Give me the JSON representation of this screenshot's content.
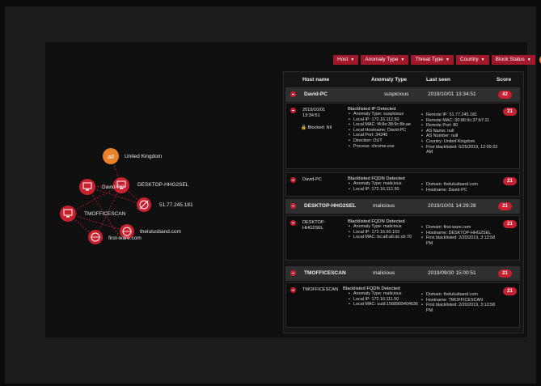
{
  "filters": [
    "Host",
    "Anomaly Type",
    "Threat Type",
    "Country",
    "Block Status"
  ],
  "user_badge": "a8",
  "colors": {
    "accent": "#c8202f",
    "filter_bg": "#a0182a",
    "node_orange": "#e8812a",
    "panel_bg": "#151515"
  },
  "graph": {
    "nodes": [
      {
        "label": "United Kingdom",
        "icon": "globe-icon"
      },
      {
        "label": "David-PC",
        "icon": "computer-icon"
      },
      {
        "label": "DESKTOP-HHG2SEL",
        "icon": "computer-icon"
      },
      {
        "label": "51.77.245.181",
        "icon": "ip-icon"
      },
      {
        "label": "TMOFFICESCAN",
        "icon": "computer-icon"
      },
      {
        "label": "thelulusband.com",
        "icon": "domain-icon"
      },
      {
        "label": "first-ware.com",
        "icon": "domain-icon"
      }
    ]
  },
  "table": {
    "headers": {
      "host": "Host name",
      "type": "Anomaly Type",
      "seen": "Last seen",
      "score": "Score"
    },
    "groups": [
      {
        "host": "David-PC",
        "type": "suspicious",
        "seen": "2019/10/01 13:34:51",
        "score": "42"
      },
      {
        "host": "DESKTOP-HHG2SEL",
        "type": "malicious",
        "seen": "2019/10/01 14:29:28",
        "score": "21"
      },
      {
        "host": "TMOFFICESCAN",
        "type": "malicious",
        "seen": "2019/09/30 15:00:51",
        "score": "21"
      }
    ]
  },
  "details": {
    "d1": {
      "date": "2019/10/01",
      "time": "13:34:51",
      "blocked": "Blocked: Nil",
      "title": "Blacklisted IP Detected",
      "score": "21",
      "left": [
        "Anomaly Type: suspicious",
        "Local IP: 172.16.112.50",
        "Local MAC: f4:8e:38:9c:8b:ae",
        "Local Hostname: David-PC",
        "Local Port: 34346",
        "Direction: OUT",
        "Process: chrome.exe"
      ],
      "right": [
        "Remote IP: 51.77.245.181",
        "Remote MAC: 00:86:9c:37:b7:11",
        "Remote Port: 80",
        "AS Name: null",
        "AS Number: null",
        "Country: United Kingdom",
        "First blacklisted: 6/25/2019, 12:00:33 AM"
      ]
    },
    "d2": {
      "host": "David-PC",
      "title": "Blacklisted FQDN Detected",
      "score": "21",
      "left": [
        "Anomaly Type: malicious",
        "Local IP: 172.16.112.50"
      ],
      "right": [
        "Domain: thelulusband.com",
        "Hostname: David-PC"
      ]
    },
    "d3": {
      "host": "DESKTOP-HHG2SEL",
      "title": "Blacklisted FQDN Detected",
      "score": "21",
      "left": [
        "Anomaly Type: malicious",
        "Local IP: 172.16.60.103",
        "Local MAC: bc:a8:a6:dc:cb:70"
      ],
      "right": [
        "Domain: first-ware.com",
        "Hostname: DESKTOP-HHG2SEL",
        "First blacklisted: 2/20/2019, 3:13:58 PM"
      ]
    },
    "d4": {
      "host": "TMOFFICESCAN",
      "title": "Blacklisted FQDN Detected",
      "score": "21",
      "left": [
        "Anomaly Type: malicious",
        "Local IP: 172.16.111.50",
        "Local MAC: uuid:1568909404636"
      ],
      "right": [
        "Domain: thelulusband.com",
        "Hostname: TMOFFICESCAN",
        "First blacklisted: 2/20/2019, 3:13:58 PM"
      ]
    }
  }
}
